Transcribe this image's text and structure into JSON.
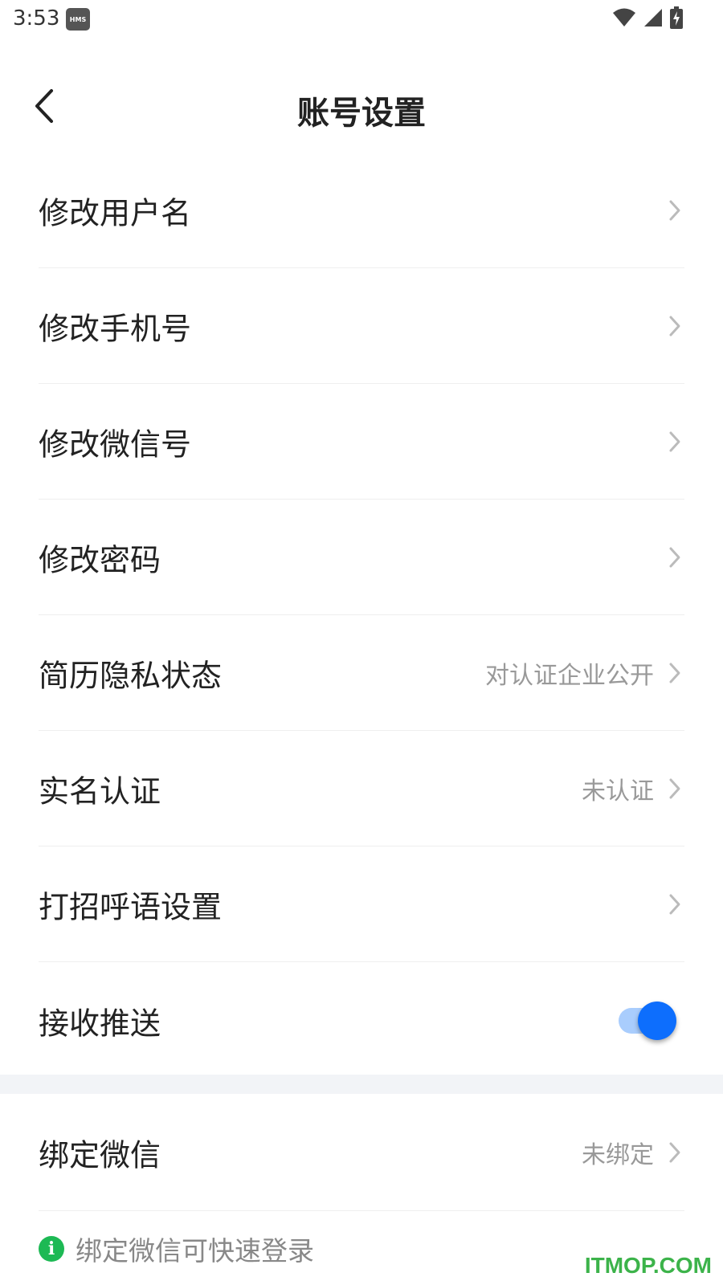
{
  "status_bar": {
    "time": "3:53",
    "badge": "HMS",
    "icons": [
      "wifi-icon",
      "signal-icon",
      "battery-icon"
    ]
  },
  "nav": {
    "title": "账号设置",
    "back_icon": "chevron-left-icon"
  },
  "settings": [
    {
      "label": "修改用户名",
      "value": ""
    },
    {
      "label": "修改手机号",
      "value": ""
    },
    {
      "label": "修改微信号",
      "value": ""
    },
    {
      "label": "修改密码",
      "value": ""
    },
    {
      "label": "简历隐私状态",
      "value": "对认证企业公开"
    },
    {
      "label": "实名认证",
      "value": "未认证"
    },
    {
      "label": "打招呼语设置",
      "value": ""
    }
  ],
  "push": {
    "label": "接收推送",
    "enabled": true,
    "accent": "#0d6efd"
  },
  "wechat": {
    "label": "绑定微信",
    "value": "未绑定",
    "hint": "绑定微信可快速登录",
    "hint_icon": "info-icon",
    "hint_icon_color": "#1db954"
  },
  "watermark": "ITMOP.COM"
}
